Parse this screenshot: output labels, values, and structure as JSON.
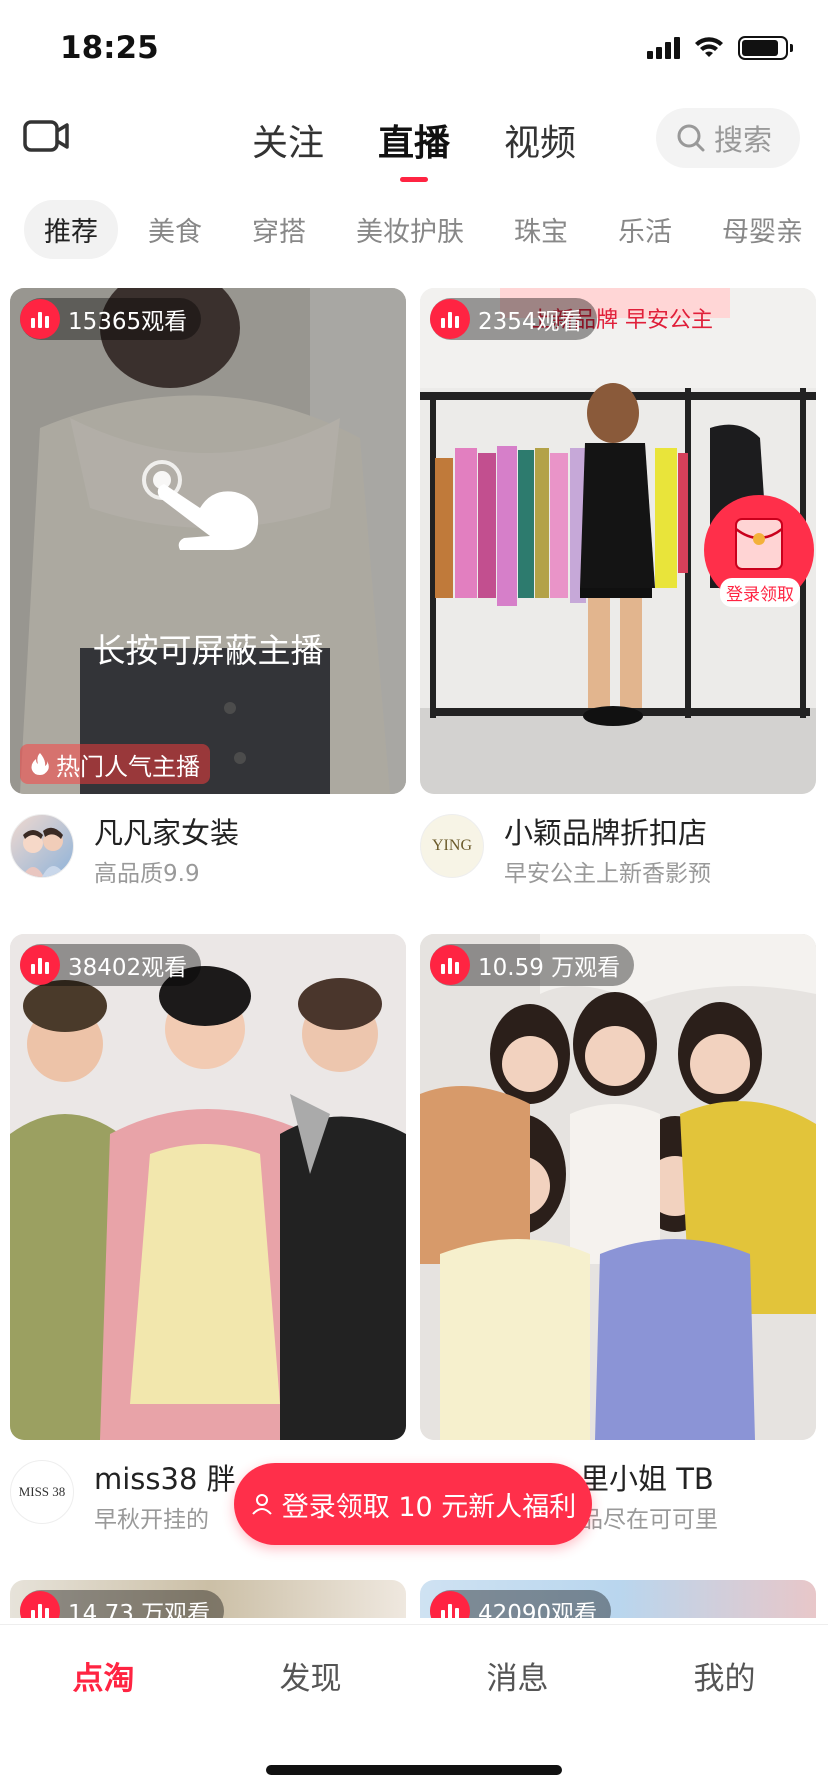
{
  "status_bar": {
    "time": "18:25"
  },
  "top_nav": {
    "tabs": [
      {
        "label": "关注",
        "active": false
      },
      {
        "label": "直播",
        "active": true
      },
      {
        "label": "视频",
        "active": false
      }
    ],
    "search_label": "搜索"
  },
  "categories": [
    "推荐",
    "美食",
    "穿搭",
    "美妆护肤",
    "珠宝",
    "乐活",
    "母婴亲"
  ],
  "cards": [
    {
      "viewers": "15365观看",
      "hint": "长按可屏蔽主播",
      "hot_tag": "热门人气主播",
      "shop_name": "凡凡家女装",
      "subtitle": "高品质9.9"
    },
    {
      "viewers": "2354观看",
      "banner_text": "上新品牌 早安公主",
      "shop_name": "小颖品牌折扣店",
      "subtitle": "早安公主上新香影预",
      "avatar_text": "YING"
    },
    {
      "viewers": "38402观看",
      "shop_name": "miss38 胖",
      "subtitle": "早秋开挂的",
      "avatar_text": "MISS 38"
    },
    {
      "viewers": "10.59 万观看",
      "shop_name": "里小姐 TB",
      "subtitle": "品尽在可可里"
    },
    {
      "viewers": "14.73 万观看"
    },
    {
      "viewers": "42090观看"
    }
  ],
  "red_packet_label": "登录领取",
  "login_button": "登录领取 10 元新人福利",
  "bottom_tabs": [
    {
      "label": "点淘",
      "active": true
    },
    {
      "label": "发现",
      "active": false
    },
    {
      "label": "消息",
      "active": false
    },
    {
      "label": "我的",
      "active": false
    }
  ],
  "colors": {
    "accent": "#ff2442",
    "muted_text": "#999999"
  }
}
